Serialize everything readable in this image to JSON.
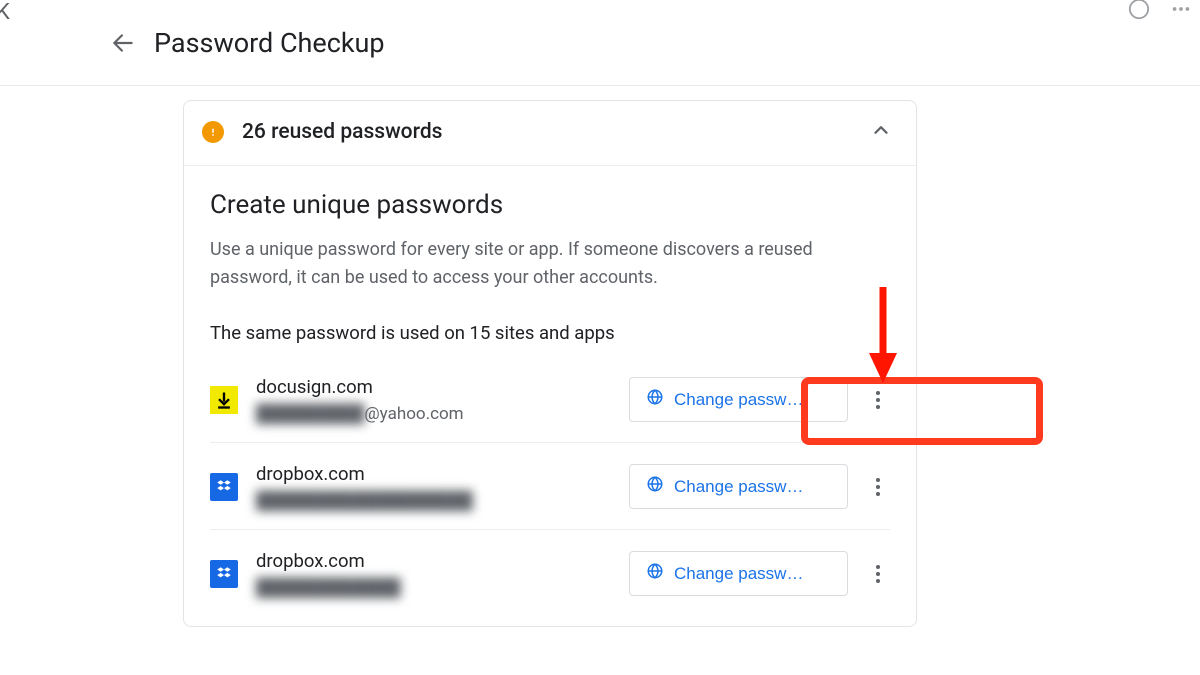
{
  "header": {
    "title": "Password Checkup"
  },
  "card": {
    "header": "26 reused passwords",
    "section_title": "Create unique passwords",
    "section_desc": "Use a unique password for every site or app. If someone discovers a reused password, it can be used to access your other accounts.",
    "group_label": "The same password is used on 15 sites and apps",
    "change_label": "Change passw…",
    "entries": [
      {
        "site": "docusign.com",
        "user_prefix": "█████████",
        "user_suffix": "@yahoo.com",
        "icon": "download"
      },
      {
        "site": "dropbox.com",
        "user_prefix": "██████████████████",
        "user_suffix": "",
        "icon": "dropbox"
      },
      {
        "site": "dropbox.com",
        "user_prefix": "████████████",
        "user_suffix": "",
        "icon": "dropbox"
      }
    ]
  }
}
